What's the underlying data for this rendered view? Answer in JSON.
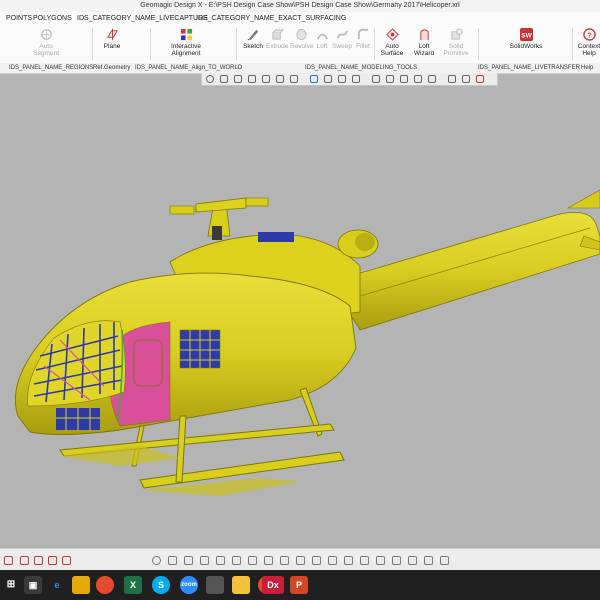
{
  "window": {
    "title": "Geomagic Design X - E:\\PSH Design Case Show\\PSH Design Case Show\\Germany 2017\\Helicoper.xrl"
  },
  "menu_tabs": [
    "POINTS",
    "POLYGONS",
    "IDS_CATEGORY_NAME_LIVECAPTURE",
    "IDS_CATEGORY_NAME_EXACT_SURFACING"
  ],
  "ribbon": {
    "auto_segment": "Auto Segment",
    "plane": "Plane",
    "interactive_alignment": "Interactive Alignment",
    "sketch": "Sketch",
    "extrude": "Extrude",
    "revolve": "Revolve",
    "loft": "Loft",
    "sweep": "Sweep",
    "fillet": "Fillet",
    "auto_surface": "Auto Surface",
    "loft_wizard": "Loft Wizard",
    "solid_primitive": "Solid Primitive",
    "solidworks": "SolidWorks",
    "context_help": "Context Help"
  },
  "groups": {
    "regions": "IDS_PANEL_NAME_REGIONS",
    "ref_geometry": "Ref.Geometry",
    "align_to_world": "IDS_PANEL_NAME_Align_TO_WORLD",
    "modeling_tools": "IDS_PANEL_NAME_MODELING_TOOLS",
    "livetransfer": "IDS_PANEL_NAME_LIVETRANSFER",
    "help": "Help"
  },
  "model": {
    "body_color": "#dcd21e",
    "pink_panel": "#d8509a",
    "mesh_blue": "#2d3aa8",
    "edge_green": "#3cae3c"
  },
  "taskbar": {
    "apps": [
      "start-icon",
      "search-icon",
      "task-view-icon",
      "edge-icon",
      "file-explorer-icon",
      "store-icon",
      "chrome-icon",
      "excel-icon",
      "skype-icon",
      "zoom-icon",
      "photos-icon",
      "folder-icon",
      "chrome-icon-2",
      "dx-icon",
      "powerpoint-icon"
    ],
    "dx_label": "Dx",
    "excel_label": "X",
    "skype_label": "S",
    "ppt_label": "P"
  }
}
